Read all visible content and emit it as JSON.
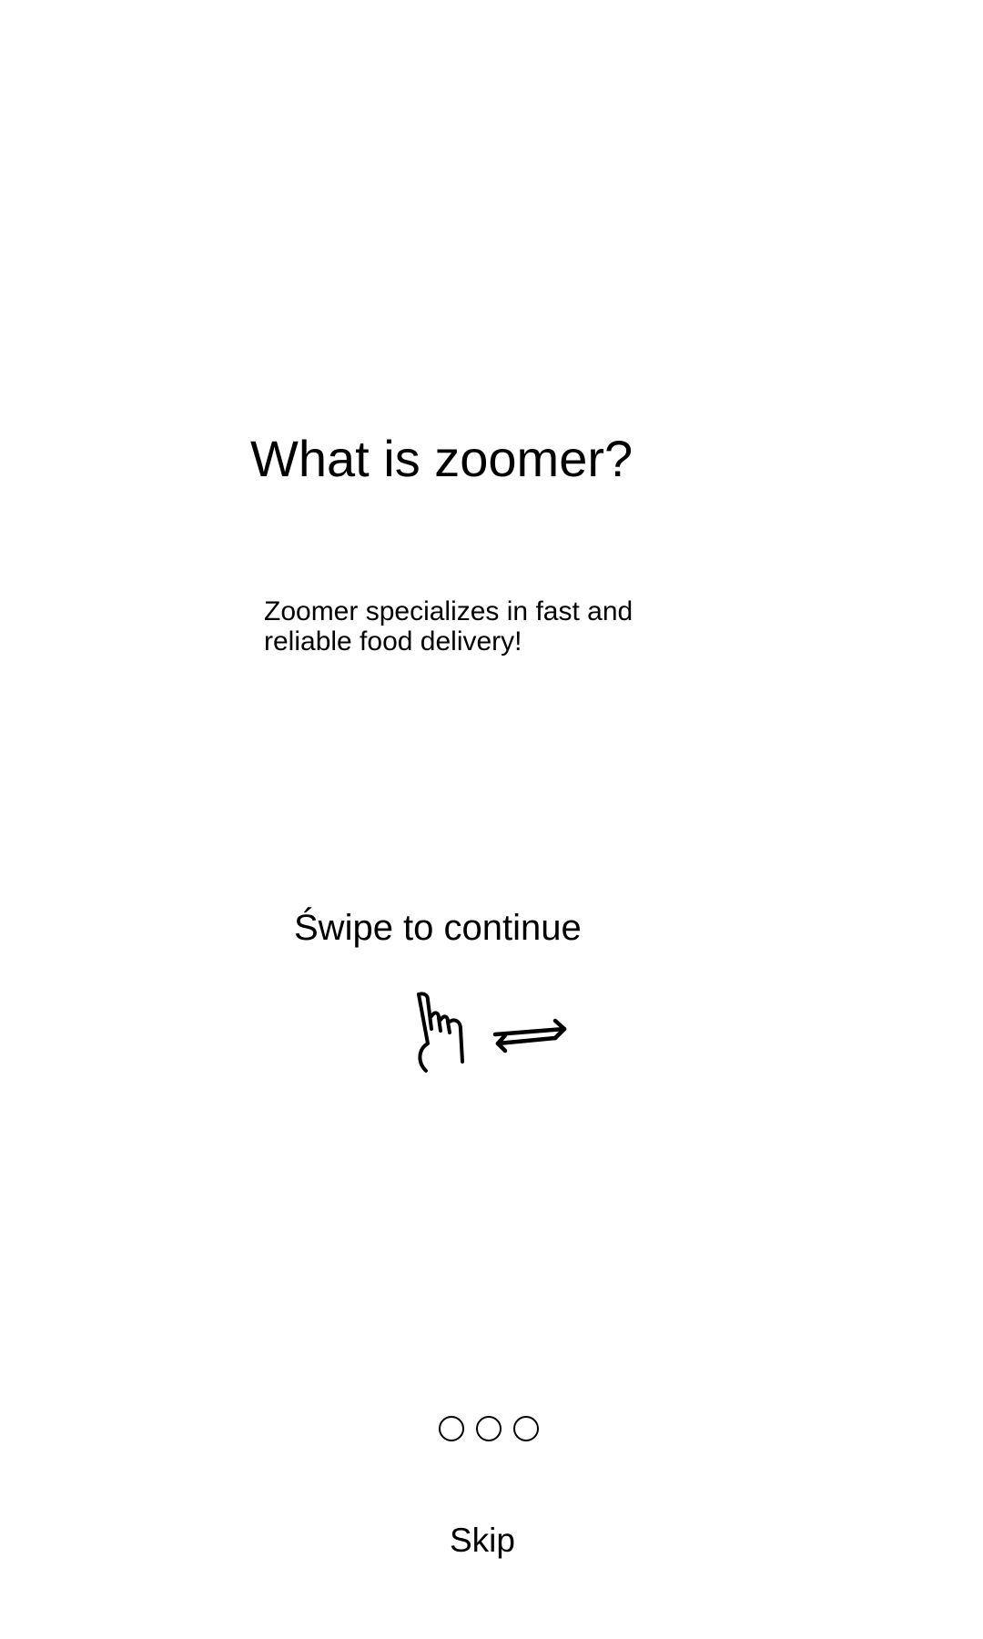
{
  "onboarding": {
    "title": "What is zoomer?",
    "description": "Zoomer specializes in fast and reliable food delivery!",
    "swipe_hint": "Świpe to continue",
    "swipe_icons": [
      "hand-pointer-icon",
      "swap-horizontal-arrows-icon"
    ],
    "pagination": {
      "total_pages": 3,
      "active_page": null
    },
    "skip_label": "Skip"
  },
  "colors": {
    "background": "#ffffff",
    "foreground": "#000000"
  }
}
